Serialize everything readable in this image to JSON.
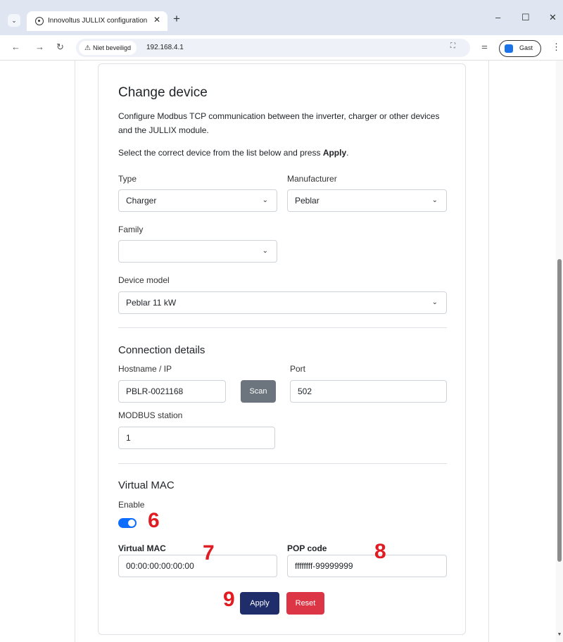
{
  "browser": {
    "tab_title": "Innovoltus JULLIX configuration",
    "tab_close": "✕",
    "new_tab": "+",
    "window_controls": {
      "minimize": "–",
      "maximize": "☐",
      "close": "✕"
    },
    "security_label": "Niet beveiligd",
    "url": "192.168.4.1",
    "profile_label": "Gast",
    "icons": [
      "search-tabs-icon",
      "back-arrow-icon",
      "forward-arrow-icon",
      "reload-icon",
      "warning-icon",
      "translate-icon",
      "cast-icon",
      "menu-kebab-icon"
    ]
  },
  "form": {
    "title": "Change device",
    "intro": "Configure Modbus TCP communication between the inverter, charger or other devices and the JULLIX module.",
    "instruction_prefix": "Select the correct device from the list below and press ",
    "instruction_bold": "Apply",
    "instruction_suffix": ".",
    "type": {
      "label": "Type",
      "value": "Charger"
    },
    "manufacturer": {
      "label": "Manufacturer",
      "value": "Peblar"
    },
    "family": {
      "label": "Family",
      "value": ""
    },
    "device_model": {
      "label": "Device model",
      "value": "Peblar 11 kW"
    },
    "connection": {
      "title": "Connection details",
      "hostname": {
        "label": "Hostname / IP",
        "value": "PBLR-0021168"
      },
      "scan_label": "Scan",
      "port": {
        "label": "Port",
        "value": "502"
      },
      "modbus_station": {
        "label": "MODBUS station",
        "value": "1"
      }
    },
    "virtual_mac": {
      "title": "Virtual MAC",
      "enable_label": "Enable",
      "enabled": true,
      "mac": {
        "label": "Virtual MAC",
        "value": "00:00:00:00:00:00"
      },
      "pop": {
        "label": "POP code",
        "value": "ffffffff-99999999"
      }
    },
    "apply_label": "Apply",
    "reset_label": "Reset"
  },
  "markers": {
    "m6": "6",
    "m7": "7",
    "m8": "8",
    "m9": "9"
  },
  "colors": {
    "primary": "#1f2d6b",
    "danger": "#dc3545",
    "secondary": "#6c757d",
    "toggle": "#0d6efd",
    "marker": "#e01b22"
  }
}
